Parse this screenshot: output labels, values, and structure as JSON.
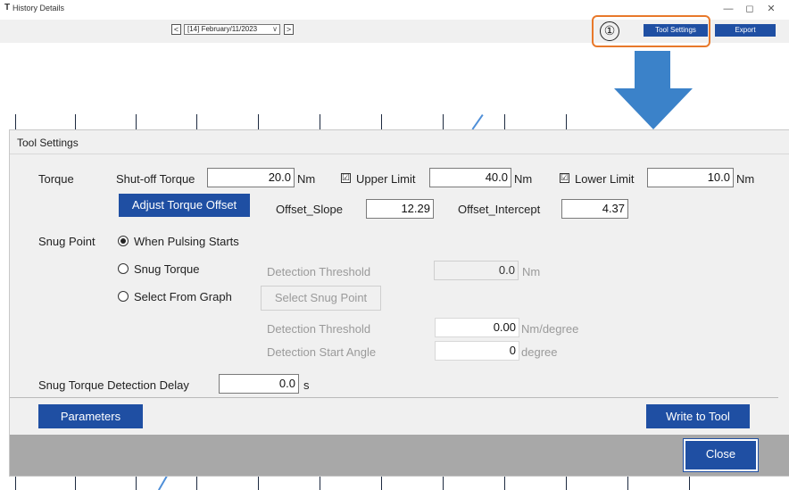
{
  "window": {
    "title": "History Details",
    "app_icon": "T",
    "minimize": "—",
    "maximize": "◻",
    "close": "✕"
  },
  "toolbar": {
    "prev": "<",
    "next": ">",
    "date_value": "[14] February/11/2023",
    "chevron": "∨",
    "callout_number": "①",
    "tool_settings_label": "Tool Settings",
    "export_label": "Export"
  },
  "dialog": {
    "title": "Tool Settings",
    "torque": {
      "section_label": "Torque",
      "shutoff_label": "Shut-off Torque",
      "shutoff_value": "20.0",
      "unit_nm": "Nm",
      "upper_label": "Upper Limit",
      "upper_checked": "☑",
      "upper_value": "40.0",
      "lower_label": "Lower Limit",
      "lower_checked": "☑",
      "lower_value": "10.0",
      "adjust_btn": "Adjust Torque Offset",
      "slope_label": "Offset_Slope",
      "slope_value": "12.29",
      "intercept_label": "Offset_Intercept",
      "intercept_value": "4.37"
    },
    "snug": {
      "section_label": "Snug Point",
      "opt1": "When Pulsing Starts",
      "opt2": "Snug Torque",
      "opt3": "Select From Graph",
      "detection_threshold_label": "Detection Threshold",
      "threshold1_value": "0.0",
      "threshold1_unit": "Nm",
      "select_snug_btn": "Select Snug Point",
      "threshold2_label": "Detection Threshold",
      "threshold2_value": "0.00",
      "threshold2_unit": "Nm/degree",
      "start_angle_label": "Detection Start Angle",
      "start_angle_value": "0",
      "start_angle_unit": "degree"
    },
    "delay": {
      "label": "Snug Torque Detection Delay",
      "value": "0.0",
      "unit": "s"
    },
    "parameters_btn": "Parameters",
    "write_btn": "Write to Tool",
    "close_btn": "Close"
  }
}
